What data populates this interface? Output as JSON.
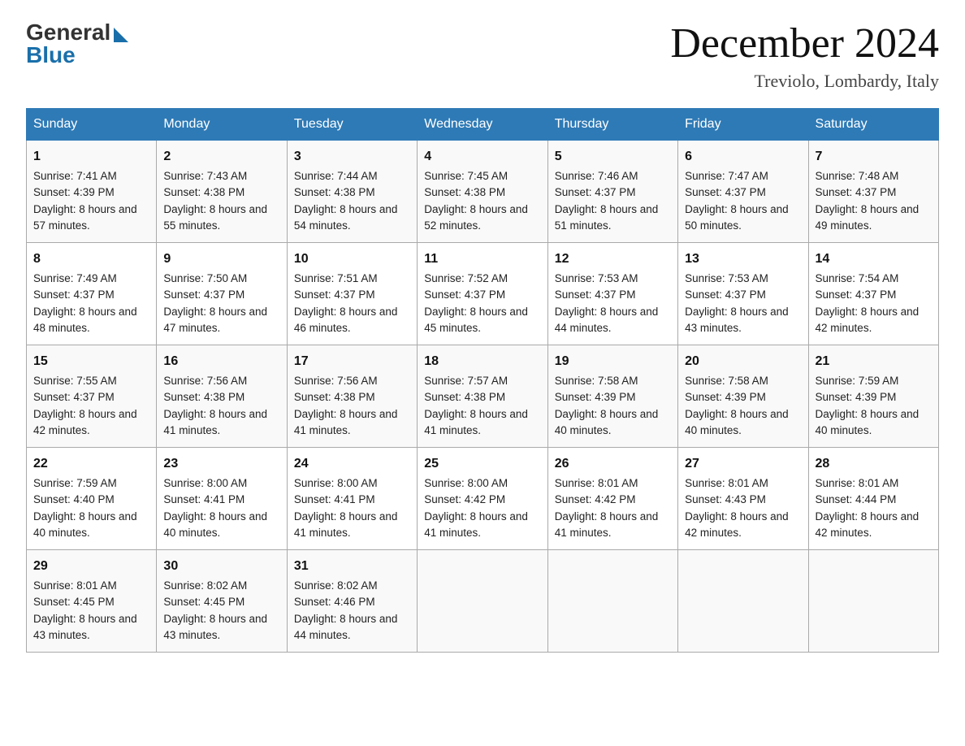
{
  "header": {
    "logo_general": "General",
    "logo_blue": "Blue",
    "month_title": "December 2024",
    "location": "Treviolo, Lombardy, Italy"
  },
  "days_of_week": [
    "Sunday",
    "Monday",
    "Tuesday",
    "Wednesday",
    "Thursday",
    "Friday",
    "Saturday"
  ],
  "weeks": [
    [
      {
        "day": 1,
        "sunrise": "7:41 AM",
        "sunset": "4:39 PM",
        "daylight": "8 hours and 57 minutes."
      },
      {
        "day": 2,
        "sunrise": "7:43 AM",
        "sunset": "4:38 PM",
        "daylight": "8 hours and 55 minutes."
      },
      {
        "day": 3,
        "sunrise": "7:44 AM",
        "sunset": "4:38 PM",
        "daylight": "8 hours and 54 minutes."
      },
      {
        "day": 4,
        "sunrise": "7:45 AM",
        "sunset": "4:38 PM",
        "daylight": "8 hours and 52 minutes."
      },
      {
        "day": 5,
        "sunrise": "7:46 AM",
        "sunset": "4:37 PM",
        "daylight": "8 hours and 51 minutes."
      },
      {
        "day": 6,
        "sunrise": "7:47 AM",
        "sunset": "4:37 PM",
        "daylight": "8 hours and 50 minutes."
      },
      {
        "day": 7,
        "sunrise": "7:48 AM",
        "sunset": "4:37 PM",
        "daylight": "8 hours and 49 minutes."
      }
    ],
    [
      {
        "day": 8,
        "sunrise": "7:49 AM",
        "sunset": "4:37 PM",
        "daylight": "8 hours and 48 minutes."
      },
      {
        "day": 9,
        "sunrise": "7:50 AM",
        "sunset": "4:37 PM",
        "daylight": "8 hours and 47 minutes."
      },
      {
        "day": 10,
        "sunrise": "7:51 AM",
        "sunset": "4:37 PM",
        "daylight": "8 hours and 46 minutes."
      },
      {
        "day": 11,
        "sunrise": "7:52 AM",
        "sunset": "4:37 PM",
        "daylight": "8 hours and 45 minutes."
      },
      {
        "day": 12,
        "sunrise": "7:53 AM",
        "sunset": "4:37 PM",
        "daylight": "8 hours and 44 minutes."
      },
      {
        "day": 13,
        "sunrise": "7:53 AM",
        "sunset": "4:37 PM",
        "daylight": "8 hours and 43 minutes."
      },
      {
        "day": 14,
        "sunrise": "7:54 AM",
        "sunset": "4:37 PM",
        "daylight": "8 hours and 42 minutes."
      }
    ],
    [
      {
        "day": 15,
        "sunrise": "7:55 AM",
        "sunset": "4:37 PM",
        "daylight": "8 hours and 42 minutes."
      },
      {
        "day": 16,
        "sunrise": "7:56 AM",
        "sunset": "4:38 PM",
        "daylight": "8 hours and 41 minutes."
      },
      {
        "day": 17,
        "sunrise": "7:56 AM",
        "sunset": "4:38 PM",
        "daylight": "8 hours and 41 minutes."
      },
      {
        "day": 18,
        "sunrise": "7:57 AM",
        "sunset": "4:38 PM",
        "daylight": "8 hours and 41 minutes."
      },
      {
        "day": 19,
        "sunrise": "7:58 AM",
        "sunset": "4:39 PM",
        "daylight": "8 hours and 40 minutes."
      },
      {
        "day": 20,
        "sunrise": "7:58 AM",
        "sunset": "4:39 PM",
        "daylight": "8 hours and 40 minutes."
      },
      {
        "day": 21,
        "sunrise": "7:59 AM",
        "sunset": "4:39 PM",
        "daylight": "8 hours and 40 minutes."
      }
    ],
    [
      {
        "day": 22,
        "sunrise": "7:59 AM",
        "sunset": "4:40 PM",
        "daylight": "8 hours and 40 minutes."
      },
      {
        "day": 23,
        "sunrise": "8:00 AM",
        "sunset": "4:41 PM",
        "daylight": "8 hours and 40 minutes."
      },
      {
        "day": 24,
        "sunrise": "8:00 AM",
        "sunset": "4:41 PM",
        "daylight": "8 hours and 41 minutes."
      },
      {
        "day": 25,
        "sunrise": "8:00 AM",
        "sunset": "4:42 PM",
        "daylight": "8 hours and 41 minutes."
      },
      {
        "day": 26,
        "sunrise": "8:01 AM",
        "sunset": "4:42 PM",
        "daylight": "8 hours and 41 minutes."
      },
      {
        "day": 27,
        "sunrise": "8:01 AM",
        "sunset": "4:43 PM",
        "daylight": "8 hours and 42 minutes."
      },
      {
        "day": 28,
        "sunrise": "8:01 AM",
        "sunset": "4:44 PM",
        "daylight": "8 hours and 42 minutes."
      }
    ],
    [
      {
        "day": 29,
        "sunrise": "8:01 AM",
        "sunset": "4:45 PM",
        "daylight": "8 hours and 43 minutes."
      },
      {
        "day": 30,
        "sunrise": "8:02 AM",
        "sunset": "4:45 PM",
        "daylight": "8 hours and 43 minutes."
      },
      {
        "day": 31,
        "sunrise": "8:02 AM",
        "sunset": "4:46 PM",
        "daylight": "8 hours and 44 minutes."
      },
      null,
      null,
      null,
      null
    ]
  ]
}
